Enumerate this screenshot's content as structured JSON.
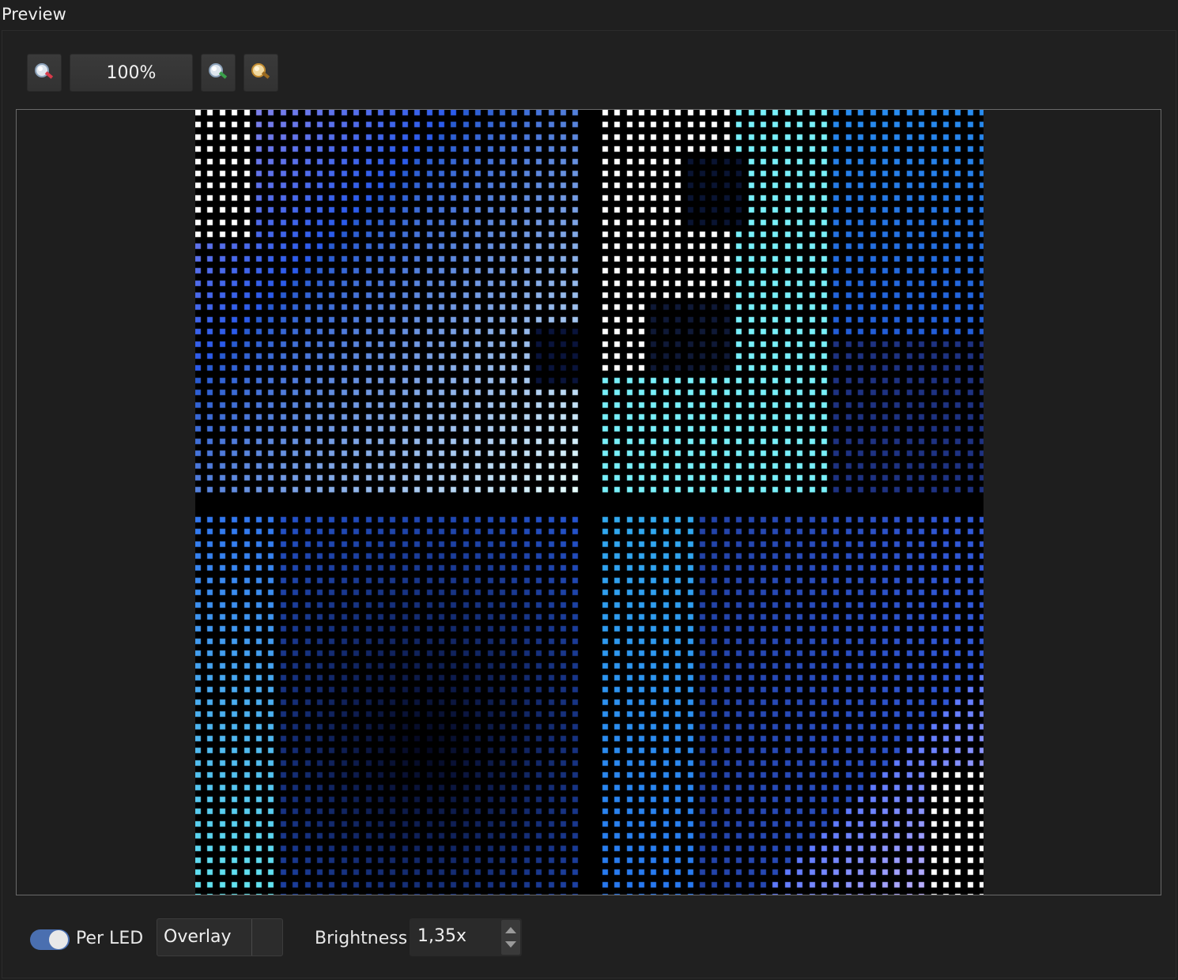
{
  "panel": {
    "title": "Preview"
  },
  "toolbar": {
    "zoom_out_icon": "zoom-out-icon",
    "zoom_level": "100%",
    "zoom_in_icon": "zoom-in-icon",
    "zoom_fit_icon": "zoom-fit-icon"
  },
  "bottom": {
    "per_led_label": "Per LED",
    "per_led_enabled": true,
    "mode_value": "Overlay",
    "brightness_label": "Brightness",
    "brightness_value": "1,35x"
  },
  "colors": {
    "background": "#1f1f1f",
    "toggle_on": "#4a6fb0",
    "led_blue": "#2a74e0",
    "led_cyan": "#5fe0f0",
    "led_white": "#ffffff"
  }
}
